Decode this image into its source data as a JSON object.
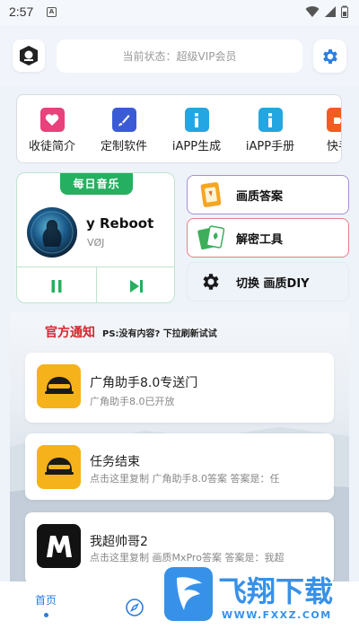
{
  "status_bar": {
    "time": "2:57",
    "notification_letter": "A"
  },
  "header": {
    "status_text": "当前状态：超级VIP会员"
  },
  "menu": {
    "items": [
      {
        "label": "收徒简介",
        "icon": "heart-icon",
        "color": "#e8417c"
      },
      {
        "label": "定制软件",
        "icon": "brush-icon",
        "color": "#3b5bd6"
      },
      {
        "label": "iAPP生成",
        "icon": "info-icon",
        "color": "#23a6e2"
      },
      {
        "label": "iAPP手册",
        "icon": "info-icon",
        "color": "#23a6e2"
      },
      {
        "label": "快手",
        "icon": "video-icon",
        "color": "#f25c22"
      }
    ]
  },
  "music": {
    "tag": "每日音乐",
    "title": "y Reboot",
    "artist": "VØJ"
  },
  "tools": [
    {
      "label": "画质答案",
      "icon": "card-icon"
    },
    {
      "label": "解密工具",
      "icon": "poker-cards-icon"
    },
    {
      "label": "切换 画质DIY",
      "icon": "gear-icon"
    }
  ],
  "notice": {
    "title": "官方通知",
    "tip": "PS:没有内容? 下拉刷新试试",
    "cards": [
      {
        "title": "广角助手8.0专送门",
        "subtitle": "广角助手8.0已开放"
      },
      {
        "title": "任务结束",
        "subtitle": "点击这里复制 广角助手8.0答案   答案是：任"
      },
      {
        "title": "我超帅哥2",
        "subtitle": "点击这里复制 画质MxPro答案   答案是：我超"
      }
    ]
  },
  "watermark": {
    "text": "飞翔下载",
    "url": "WWW.FXXZ.COM"
  },
  "bottom_nav": {
    "home_label": "首页"
  },
  "colors": {
    "accent": "#2a7de1",
    "green": "#24b060",
    "notice_red": "#d6262c"
  }
}
